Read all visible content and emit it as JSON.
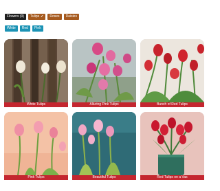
{
  "filters": {
    "flowers_label": "Flowers (9)",
    "tulips_label": "Tulips",
    "roses_label": "Roses",
    "daisies_label": "Daisies"
  },
  "colors": [
    "White",
    "Red",
    "Pink"
  ],
  "cards": [
    {
      "caption": "White Tulips"
    },
    {
      "caption": "Alluring Pink Tulips"
    },
    {
      "caption": "Bunch of Red Tulips"
    },
    {
      "caption": "Pink Tulips"
    },
    {
      "caption": "Beautiful Tulips"
    },
    {
      "caption": "Red Tulips on a Vas"
    }
  ],
  "theme": {
    "caption_bg": "#c4262f",
    "chip_dark": "#1f1f1f",
    "chip_brown": "#a65a1e",
    "chip_blue": "#1c93b5"
  },
  "icons": {
    "tulips_selected": "check-icon"
  }
}
